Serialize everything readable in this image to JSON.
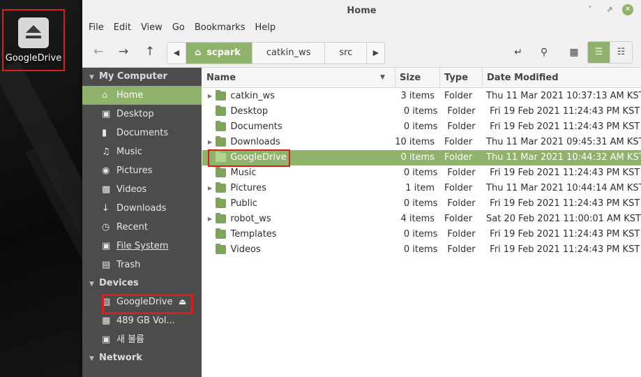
{
  "desktop": {
    "icon_label": "GoogleDrive"
  },
  "window": {
    "title": "Home"
  },
  "menubar": [
    "File",
    "Edit",
    "View",
    "Go",
    "Bookmarks",
    "Help"
  ],
  "pathbar": {
    "segments": [
      "scpark",
      "catkin_ws",
      "src"
    ]
  },
  "sidebar": {
    "sections": {
      "my_computer": "My Computer",
      "devices": "Devices",
      "network": "Network"
    },
    "places": [
      {
        "label": "Home",
        "icon": "home-icon"
      },
      {
        "label": "Desktop",
        "icon": "desktop-icon"
      },
      {
        "label": "Documents",
        "icon": "documents-icon"
      },
      {
        "label": "Music",
        "icon": "music-icon"
      },
      {
        "label": "Pictures",
        "icon": "camera-icon"
      },
      {
        "label": "Videos",
        "icon": "film-icon"
      },
      {
        "label": "Downloads",
        "icon": "download-icon"
      },
      {
        "label": "Recent",
        "icon": "clock-icon"
      },
      {
        "label": "File System",
        "icon": "drive-icon"
      },
      {
        "label": "Trash",
        "icon": "trash-icon"
      }
    ],
    "devices": [
      {
        "label": "GoogleDrive",
        "icon": "drive-icon"
      },
      {
        "label": "489 GB Vol...",
        "icon": "harddisk-icon"
      },
      {
        "label": "새 볼륨",
        "icon": "drive-icon"
      }
    ]
  },
  "list": {
    "columns": {
      "name": "Name",
      "size": "Size",
      "type": "Type",
      "date": "Date Modified"
    },
    "rows": [
      {
        "name": "catkin_ws",
        "size": "3 items",
        "type": "Folder",
        "date": "Thu 11 Mar 2021 10:37:13 AM KST",
        "expandable": true
      },
      {
        "name": "Desktop",
        "size": "0 items",
        "type": "Folder",
        "date": "Fri 19 Feb 2021 11:24:43 PM KST",
        "expandable": false
      },
      {
        "name": "Documents",
        "size": "0 items",
        "type": "Folder",
        "date": "Fri 19 Feb 2021 11:24:43 PM KST",
        "expandable": false
      },
      {
        "name": "Downloads",
        "size": "10 items",
        "type": "Folder",
        "date": "Thu 11 Mar 2021 09:45:31 AM KST",
        "expandable": true
      },
      {
        "name": "GoogleDrive",
        "size": "0 items",
        "type": "Folder",
        "date": "Thu 11 Mar 2021 10:44:32 AM KST",
        "expandable": false
      },
      {
        "name": "Music",
        "size": "0 items",
        "type": "Folder",
        "date": "Fri 19 Feb 2021 11:24:43 PM KST",
        "expandable": false
      },
      {
        "name": "Pictures",
        "size": "1 item",
        "type": "Folder",
        "date": "Thu 11 Mar 2021 10:44:14 AM KST",
        "expandable": true
      },
      {
        "name": "Public",
        "size": "0 items",
        "type": "Folder",
        "date": "Fri 19 Feb 2021 11:24:43 PM KST",
        "expandable": false
      },
      {
        "name": "robot_ws",
        "size": "4 items",
        "type": "Folder",
        "date": "Sat 20 Feb 2021 11:00:01 AM KST",
        "expandable": true
      },
      {
        "name": "Templates",
        "size": "0 items",
        "type": "Folder",
        "date": "Fri 19 Feb 2021 11:24:43 PM KST",
        "expandable": false
      },
      {
        "name": "Videos",
        "size": "0 items",
        "type": "Folder",
        "date": "Fri 19 Feb 2021 11:24:43 PM KST",
        "expandable": false
      }
    ]
  },
  "colors": {
    "accent": "#8fb36a",
    "sidebar_bg": "#4c4c4c",
    "highlight_box": "#e01b1b"
  }
}
